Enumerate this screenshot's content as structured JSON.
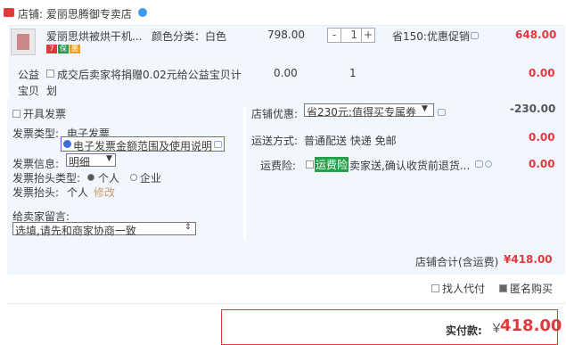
{
  "shop": {
    "label": "店铺: 爱丽思腾御专卖店"
  },
  "item": {
    "name": "爱丽思烘被烘干机...",
    "badges": [
      "7",
      "保",
      "惠"
    ],
    "color_label": "颜色分类：白色",
    "price": "798.00",
    "qty_minus": "-",
    "qty": "1",
    "qty_plus": "+",
    "promo": "省150:优惠促销",
    "subtotal": "648.00"
  },
  "charity": {
    "label_line1": "公益",
    "label_line2": "宝贝",
    "check_text_line1": "成交后卖家将捐赠0.02元给公益宝贝计",
    "check_text_line2": "划",
    "price": "0.00",
    "qty": "1",
    "subtotal": "0.00"
  },
  "invoice": {
    "open_label": "开具发票",
    "type_label": "发票类型:",
    "type_value": "电子发票",
    "tooltip": "电子发票金额范围及使用说明",
    "info_label": "发票信息:",
    "info_value": "明细",
    "title_type_label": "发票抬头类型:",
    "option_personal": "个人",
    "option_company": "企业",
    "title_label": "发票抬头:",
    "title_value": "个人",
    "edit_link": "修改"
  },
  "message": {
    "label": "给卖家留言:",
    "placeholder": "选填,请先和商家协商一致"
  },
  "shop_discount": {
    "label": "店铺优惠:",
    "selected": "省230元:值得买专属券",
    "amount": "-230.00"
  },
  "delivery": {
    "label": "运送方式:",
    "value": "普通配送 快递 免邮",
    "amount": "0.00"
  },
  "insurance": {
    "label": "运费险:",
    "tag": "运费险",
    "desc": "卖家送,确认收货前退货...",
    "amount": "0.00"
  },
  "total": {
    "label": "店铺合计(含运费)",
    "amount": "¥418.00"
  },
  "options": {
    "friend_pay": "找人代付",
    "anonymous": "匿名购买"
  },
  "payment": {
    "label": "实付款:",
    "currency": "￥",
    "amount": "418.00"
  },
  "colors": {
    "accent": "#e4393c",
    "panel": "#f2f7ff",
    "link": "#3d9cf2"
  }
}
